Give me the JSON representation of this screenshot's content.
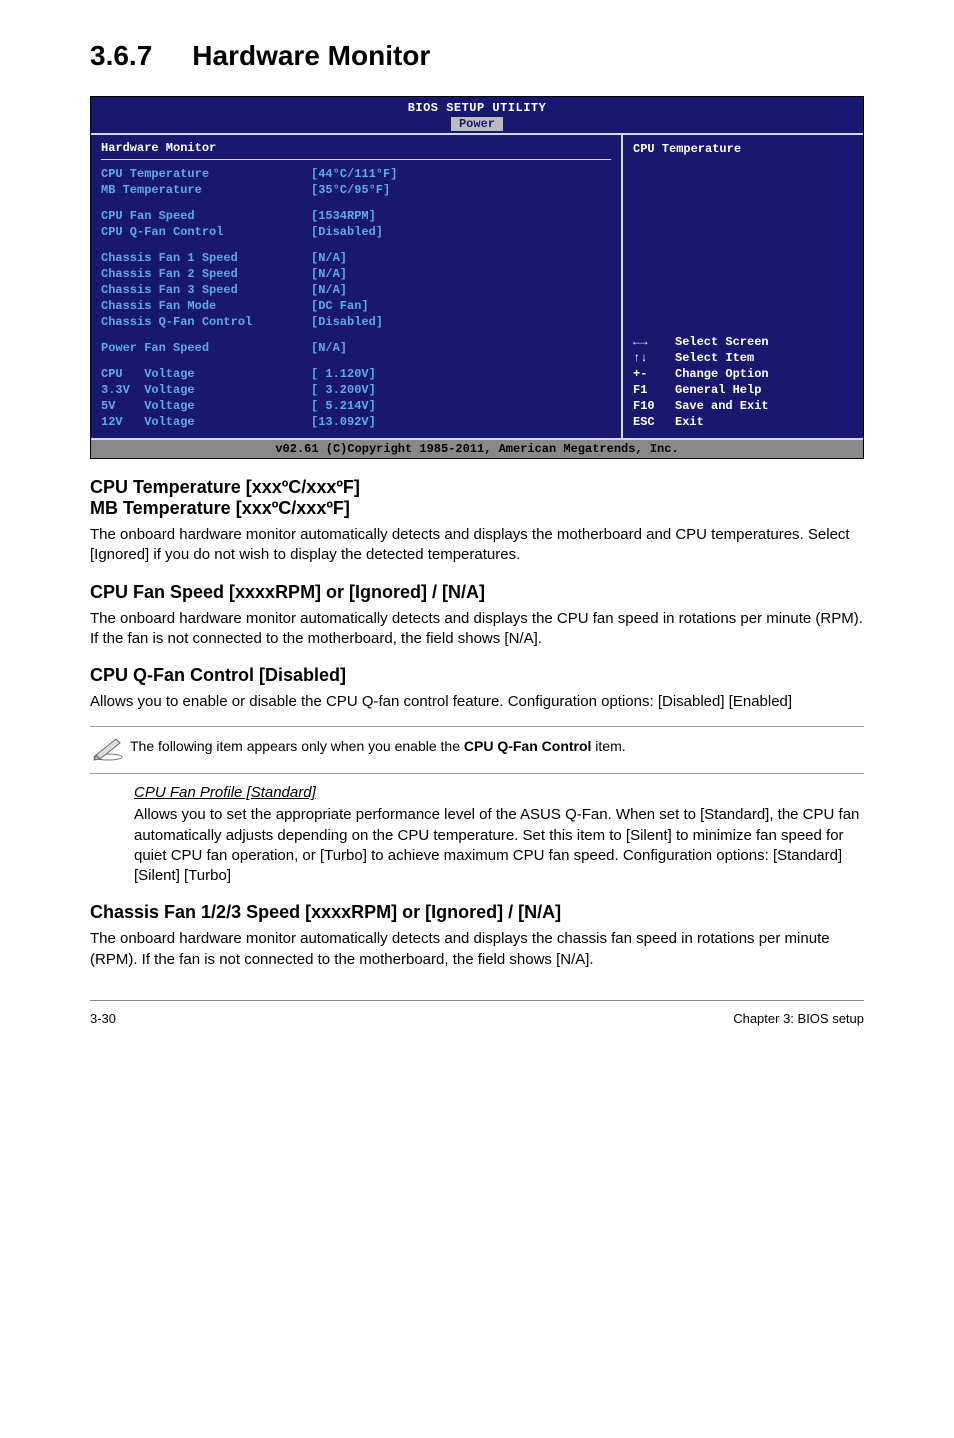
{
  "section": {
    "number": "3.6.7",
    "title": "Hardware Monitor"
  },
  "bios": {
    "title": "BIOS SETUP UTILITY",
    "tab": "Power",
    "panel_heading": "Hardware Monitor",
    "rows": [
      {
        "label": "CPU Temperature",
        "value": "[44°C/111°F]"
      },
      {
        "label": "MB Temperature",
        "value": "[35°C/95°F]"
      }
    ],
    "rows2": [
      {
        "label": "CPU Fan Speed",
        "value": "[1534RPM]"
      },
      {
        "label": "CPU Q-Fan Control",
        "value": "[Disabled]"
      }
    ],
    "rows3": [
      {
        "label": "Chassis Fan 1 Speed",
        "value": "[N/A]"
      },
      {
        "label": "Chassis Fan 2 Speed",
        "value": "[N/A]"
      },
      {
        "label": "Chassis Fan 3 Speed",
        "value": "[N/A]"
      },
      {
        "label": "Chassis Fan Mode",
        "value": "[DC Fan]"
      },
      {
        "label": "Chassis Q-Fan Control",
        "value": "[Disabled]"
      }
    ],
    "rows4": [
      {
        "label": "Power Fan Speed",
        "value": "[N/A]"
      }
    ],
    "rows5": [
      {
        "label": "CPU   Voltage",
        "value": "[ 1.120V]"
      },
      {
        "label": "3.3V  Voltage",
        "value": "[ 3.200V]"
      },
      {
        "label": "5V    Voltage",
        "value": "[ 5.214V]"
      },
      {
        "label": "12V   Voltage",
        "value": "[13.092V]"
      }
    ],
    "help_top": "CPU Temperature",
    "nav": [
      {
        "key": "←→",
        "text": "Select Screen"
      },
      {
        "key": "↑↓",
        "text": "Select Item"
      },
      {
        "key": "+-",
        "text": "Change Option"
      },
      {
        "key": "F1",
        "text": "General Help"
      },
      {
        "key": "F10",
        "text": "Save and Exit"
      },
      {
        "key": "ESC",
        "text": "Exit"
      }
    ],
    "footer": "v02.61 (C)Copyright 1985-2011, American Megatrends, Inc."
  },
  "sub1": {
    "line1": "CPU Temperature [xxxºC/xxxºF]",
    "line2": "MB Temperature [xxxºC/xxxºF]",
    "body": "The onboard hardware monitor automatically detects and displays the motherboard and CPU temperatures. Select [Ignored] if you do not wish to display the detected temperatures."
  },
  "sub2": {
    "title": "CPU Fan Speed [xxxxRPM] or [Ignored] / [N/A]",
    "body": "The onboard hardware monitor automatically detects and displays the CPU fan speed in rotations per minute (RPM). If the fan is not connected to the motherboard, the field shows [N/A]."
  },
  "sub3": {
    "title": "CPU Q-Fan Control [Disabled]",
    "body": "Allows you to enable or disable the CPU Q-fan control feature. Configuration options: [Disabled] [Enabled]"
  },
  "note": {
    "text_pre": "The following item appears only when you enable the ",
    "text_bold": "CPU Q-Fan Control",
    "text_post": " item."
  },
  "indent": {
    "title": "CPU Fan Profile [Standard]",
    "body": "Allows you to set the appropriate performance level of the ASUS Q-Fan. When set to [Standard], the CPU fan automatically adjusts depending on the CPU temperature. Set this item to [Silent] to minimize fan speed for quiet CPU fan operation, or [Turbo] to achieve maximum CPU fan speed. Configuration options: [Standard] [Silent] [Turbo]"
  },
  "sub4": {
    "title": "Chassis Fan 1/2/3 Speed [xxxxRPM] or [Ignored] / [N/A]",
    "body": "The onboard hardware monitor automatically detects and displays the chassis fan speed in rotations per minute (RPM). If the fan is not connected to the motherboard, the field shows [N/A]."
  },
  "footer": {
    "left": "3-30",
    "right": "Chapter 3: BIOS setup"
  }
}
